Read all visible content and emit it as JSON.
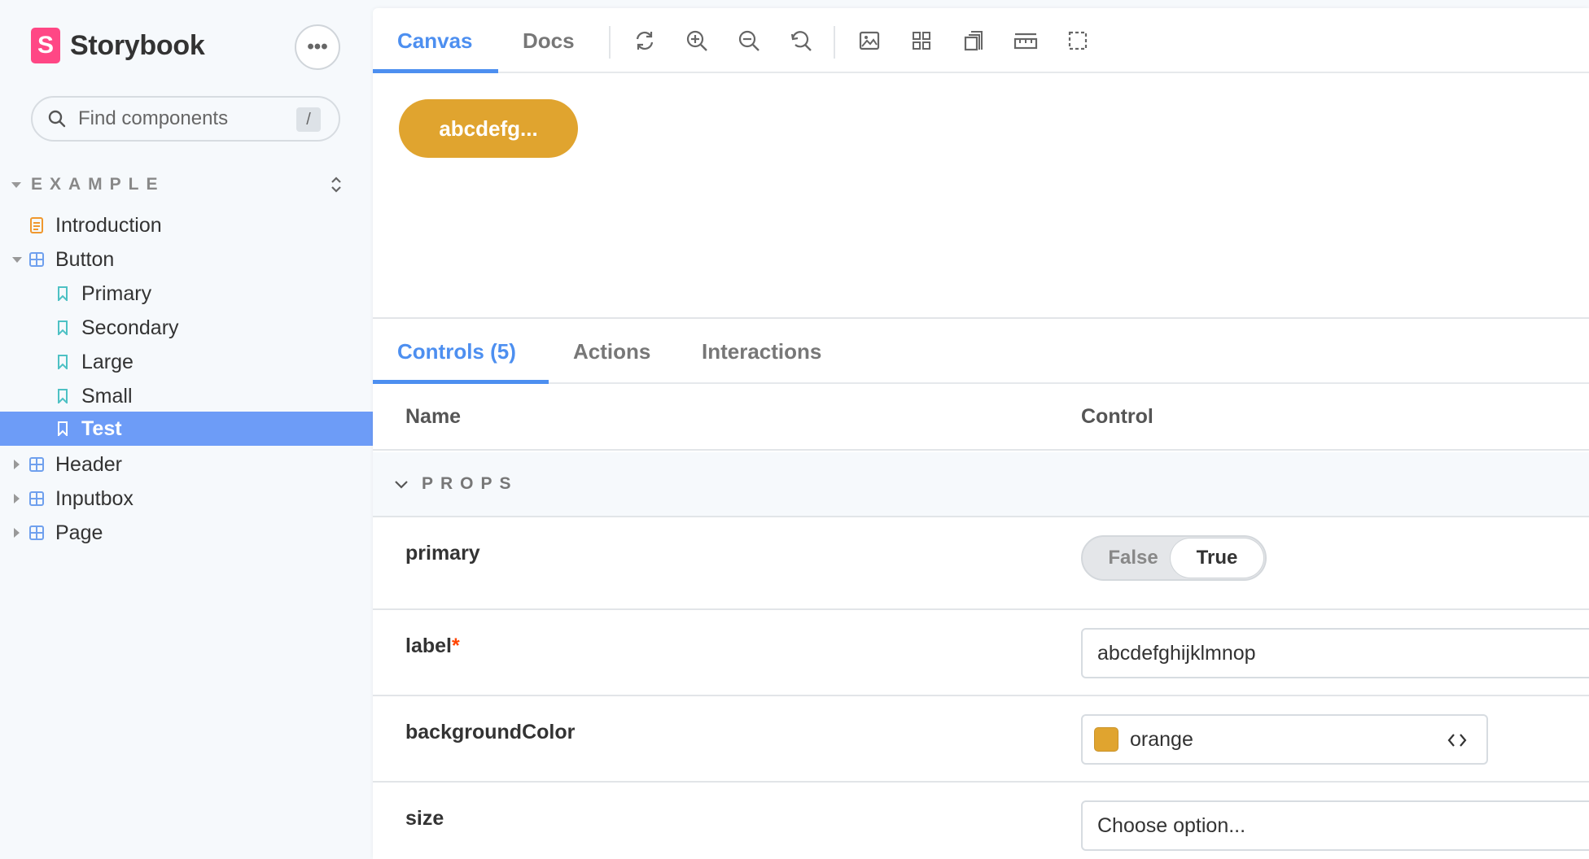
{
  "brand": {
    "logo_letter": "S",
    "name": "Storybook"
  },
  "sidebar": {
    "menu_label": "•••",
    "search": {
      "placeholder": "Find components",
      "shortcut": "/"
    },
    "group": {
      "title": "EXAMPLE"
    },
    "items": [
      {
        "label": "Introduction",
        "kind": "doc"
      },
      {
        "label": "Button",
        "kind": "component",
        "expanded": true
      },
      {
        "label": "Primary",
        "kind": "story"
      },
      {
        "label": "Secondary",
        "kind": "story"
      },
      {
        "label": "Large",
        "kind": "story"
      },
      {
        "label": "Small",
        "kind": "story"
      },
      {
        "label": "Test",
        "kind": "story",
        "selected": true
      },
      {
        "label": "Header",
        "kind": "component"
      },
      {
        "label": "Inputbox",
        "kind": "component"
      },
      {
        "label": "Page",
        "kind": "component"
      }
    ]
  },
  "toolbar": {
    "tabs": [
      {
        "label": "Canvas",
        "active": true
      },
      {
        "label": "Docs"
      }
    ],
    "tools": [
      "reload-icon",
      "zoom-in-icon",
      "zoom-out-icon",
      "reset-zoom-icon",
      "background-icon",
      "grid-icon",
      "viewport-icon",
      "measure-icon",
      "outline-icon"
    ]
  },
  "preview": {
    "button_label": "abcdefg...",
    "button_color": "#e0a42f"
  },
  "addons": {
    "tabs": [
      {
        "label": "Controls (5)",
        "active": true
      },
      {
        "label": "Actions"
      },
      {
        "label": "Interactions"
      }
    ],
    "table": {
      "col_name": "Name",
      "col_control": "Control",
      "section": "PROPS",
      "rows": {
        "primary": {
          "name": "primary",
          "false_label": "False",
          "true_label": "True",
          "value": true
        },
        "label": {
          "name": "label",
          "required_mark": "*",
          "value": "abcdefghijklmnop"
        },
        "backgroundColor": {
          "name": "backgroundColor",
          "value": "orange",
          "swatch": "#e0a42f"
        },
        "size": {
          "name": "size",
          "value": "Choose option..."
        }
      }
    }
  },
  "colors": {
    "accent": "#4d8ff0",
    "selected": "#6d9cf7",
    "brand": "#ff4785",
    "required": "#ff4400"
  }
}
